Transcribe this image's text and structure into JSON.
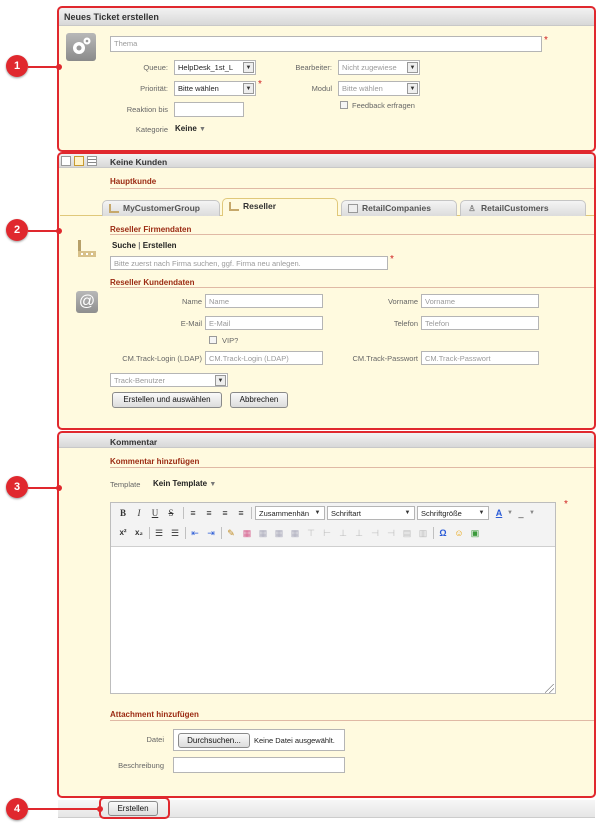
{
  "section1": {
    "header": "Neues Ticket erstellen",
    "thema_placeholder": "Thema",
    "queue_label": "Queue:",
    "queue_value": "HelpDesk_1st_L",
    "bearbeiter_label": "Bearbeiter:",
    "bearbeiter_value": "Nicht zugewiese",
    "prioritaet_label": "Priorität:",
    "prioritaet_value": "Bitte wählen",
    "modul_label": "Modul",
    "modul_value": "Bitte wählen",
    "reaktion_label": "Reaktion bis",
    "feedback_label": "Feedback erfragen",
    "kategorie_label": "Kategorie",
    "kategorie_value": "Keine"
  },
  "section2": {
    "header": "Keine Kunden",
    "hauptkunde": "Hauptkunde",
    "tabs": [
      {
        "label": "MyCustomerGroup"
      },
      {
        "label": "Reseller"
      },
      {
        "label": "RetailCompanies"
      },
      {
        "label": "RetailCustomers"
      }
    ],
    "firmendaten_title": "Reseller Firmendaten",
    "suche": "Suche",
    "separator": "|",
    "erstellen": "Erstellen",
    "firma_placeholder": "Bitte zuerst nach Firma suchen, ggf. Firma neu anlegen.",
    "kundendaten_title": "Reseller Kundendaten",
    "name_label": "Name",
    "name_placeholder": "Name",
    "vorname_label": "Vorname",
    "vorname_placeholder": "Vorname",
    "email_label": "E-Mail",
    "email_placeholder": "E-Mail",
    "telefon_label": "Telefon",
    "telefon_placeholder": "Telefon",
    "vip_label": "VIP?",
    "login_label": "CM.Track-Login (LDAP)",
    "login_placeholder": "CM.Track-Login (LDAP)",
    "passwort_label": "CM.Track-Passwort",
    "passwort_placeholder": "CM.Track-Passwort",
    "track_benutzer": "Track-Benutzer",
    "btn_create_select": "Erstellen und auswählen",
    "btn_cancel": "Abbrechen"
  },
  "section3": {
    "header": "Kommentar",
    "kommentar_title": "Kommentar hinzufügen",
    "template_label": "Template",
    "template_value": "Kein Template",
    "format_value": "Zusammenhän",
    "font_value": "Schriftart",
    "size_value": "Schriftgröße",
    "attachment_title": "Attachment hinzufügen",
    "datei_label": "Datei",
    "browse_button": "Durchsuchen...",
    "no_file": "Keine Datei ausgewählt.",
    "beschreibung_label": "Beschreibung"
  },
  "footer": {
    "submit_button": "Erstellen"
  },
  "markers": [
    "1",
    "2",
    "3",
    "4"
  ],
  "colors": {
    "accent_red": "#e0282e",
    "section_title": "#9b2a12",
    "panel_bg": "#fffadf"
  }
}
